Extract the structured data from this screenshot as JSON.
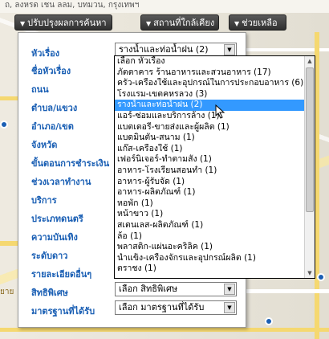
{
  "map": {
    "top_address": "ถ, ลงหรด เชน ลลม, บทมวน, กรุงเทพฯ",
    "side_label": "ยาย"
  },
  "toolbar": {
    "refine_search": "ปรับปรุงผลการค้นหา",
    "nearby_places": "สถานที่ใกล้เคียง",
    "help": "ช่วยเหลือ"
  },
  "filters": [
    {
      "label": "หัวเรื่อง",
      "value": "รางน้ำและท่อน้ำฝน (2)"
    },
    {
      "label": "ชื่อหัวเรื่อง",
      "value": ""
    },
    {
      "label": "ถนน",
      "value": ""
    },
    {
      "label": "ตำบล/แขวง",
      "value": ""
    },
    {
      "label": "อำเภอ/เขต",
      "value": ""
    },
    {
      "label": "จังหวัด",
      "value": ""
    },
    {
      "label": "ขั้นตอนการชำระเงิน",
      "value": ""
    },
    {
      "label": "ช่วงเวลาทำงาน",
      "value": ""
    },
    {
      "label": "บริการ",
      "value": ""
    },
    {
      "label": "ประเภทดนตรี",
      "value": ""
    },
    {
      "label": "ความบันเทิง",
      "value": ""
    },
    {
      "label": "ระดับดาว",
      "value": ""
    },
    {
      "label": "รายละเอียดอื่นๆ",
      "value": ""
    },
    {
      "label": "สิทธิพิเศษ",
      "value": "เลือก สิทธิพิเศษ"
    },
    {
      "label": "มาตรฐานที่ได้รับ",
      "value": "เลือก มาตรฐานที่ได้รับ"
    }
  ],
  "dropdown": {
    "selected_index": 4,
    "options": [
      "เลือก หัวเรื่อง",
      "ภัตตาคาร ร้านอาหารและสวนอาหาร (17)",
      "ครัว-เครื่องใช้และอุปกรณ์ในการประกอบอาหาร (6)",
      "โรงแรม-เขตคหรลวง (3)",
      "รางน้ำและท่อน้ำฝน (2)",
      "แอร์-ซ่อมและบริการล้าง (1)",
      "แบตเตอรี่-ขายส่งและผู้ผลิต (1)",
      "แบดมินตัน-สนาม (1)",
      "แก๊ส-เครื่องใช้ (1)",
      "เฟอร์นิเจอร์-ทำตามสั่ง (1)",
      "อาหาร-โรงเรียนสอนทำ (1)",
      "อาหาร-ผู้รับจัด (1)",
      "อาหาร-ผลิตภัณฑ์ (1)",
      "หอพัก (1)",
      "หน้าขาว (1)",
      "สเตนเลส-ผลิตภัณฑ์ (1)",
      "ล้อ (1)",
      "พลาสติก-แผ่นอะคริลิค (1)",
      "น้ำแข็ง-เครื่องจักรและอุปกรณ์ผลิต (1)",
      "ตราชง (1)"
    ]
  }
}
